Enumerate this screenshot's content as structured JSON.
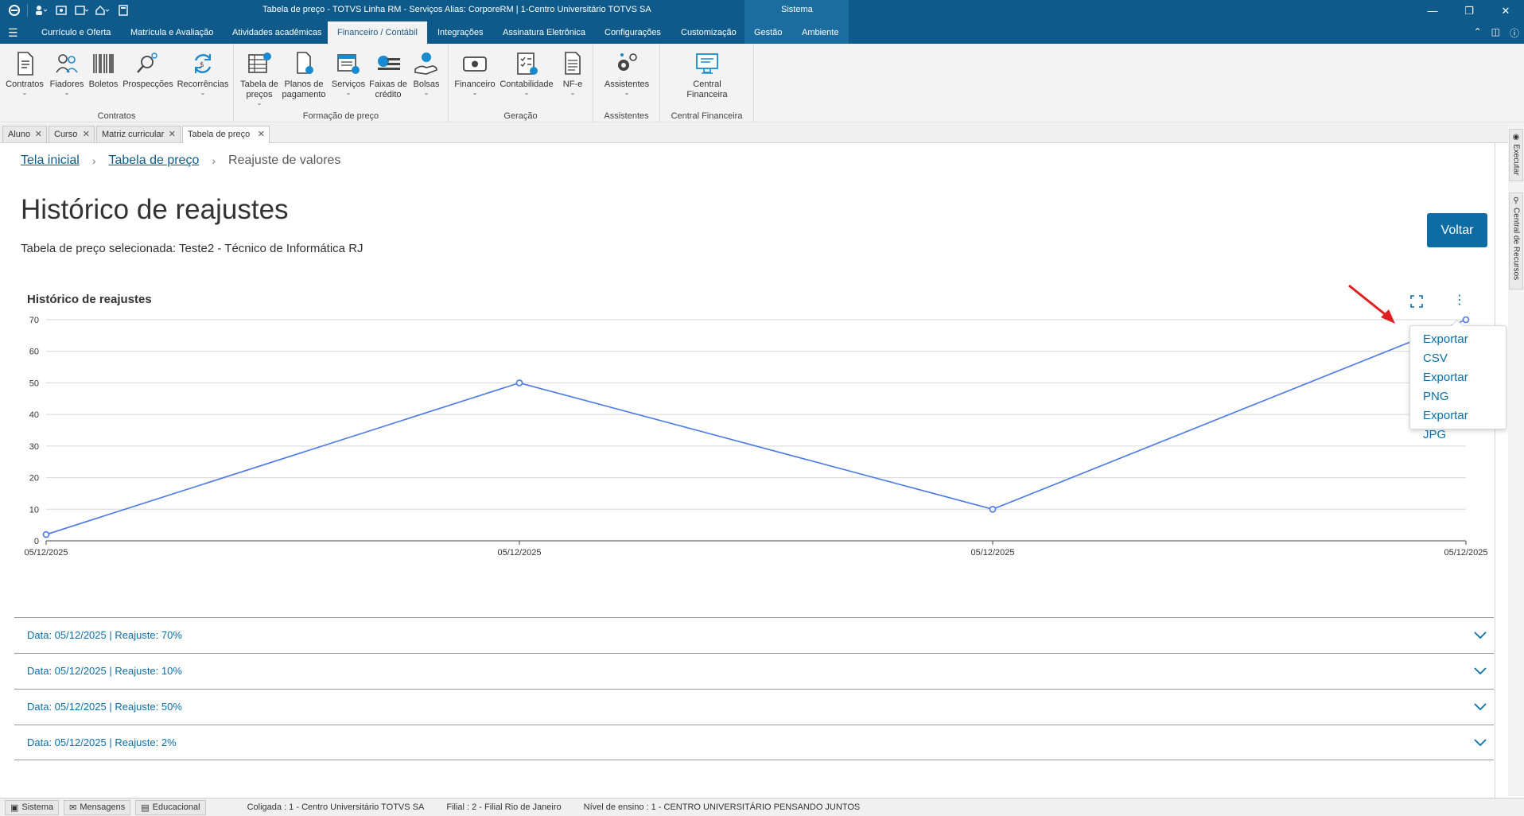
{
  "window": {
    "title": "Tabela de preço - TOTVS Linha RM - Serviços  Alias: CorporeRM | 1-Centro Universitário TOTVS SA",
    "context_tab": "Sistema"
  },
  "ribbon_tabs": [
    {
      "label": "Currículo e Oferta"
    },
    {
      "label": "Matrícula e Avaliação"
    },
    {
      "label": "Atividades acadêmicas"
    },
    {
      "label": "Financeiro / Contábil",
      "active": true
    },
    {
      "label": "Integrações"
    },
    {
      "label": "Assinatura Eletrônica"
    },
    {
      "label": "Configurações"
    },
    {
      "label": "Customização"
    },
    {
      "label": "Gestão"
    },
    {
      "label": "Ambiente"
    }
  ],
  "ribbon": {
    "groups": [
      {
        "label": "Contratos",
        "buttons": [
          {
            "label": "Contratos",
            "icon": "contract-icon",
            "dropdown": true
          },
          {
            "label": "Fiadores",
            "icon": "guarantor-icon",
            "dropdown": true
          },
          {
            "label": "Boletos",
            "icon": "barcode-icon"
          },
          {
            "label": "Prospecções",
            "icon": "prospect-icon"
          },
          {
            "label": "Recorrências",
            "icon": "recurrence-icon",
            "dropdown": true
          }
        ]
      },
      {
        "label": "Formação de preço",
        "buttons": [
          {
            "label": "Tabela de preços",
            "icon": "price-table-icon",
            "dropdown": true
          },
          {
            "label": "Planos de pagamento",
            "icon": "payment-plan-icon"
          },
          {
            "label": "Serviços",
            "icon": "services-icon",
            "dropdown": true
          },
          {
            "label": "Faixas de crédito",
            "icon": "credit-range-icon"
          },
          {
            "label": "Bolsas",
            "icon": "scholarship-icon",
            "dropdown": true
          }
        ]
      },
      {
        "label": "Geração",
        "buttons": [
          {
            "label": "Financeiro",
            "icon": "finance-icon",
            "dropdown": true
          },
          {
            "label": "Contabilidade",
            "icon": "accounting-icon",
            "dropdown": true
          },
          {
            "label": "NF-e",
            "icon": "nfe-icon",
            "dropdown": true
          }
        ]
      },
      {
        "label": "Assistentes",
        "buttons": [
          {
            "label": "Assistentes",
            "icon": "assistants-icon",
            "dropdown": true
          }
        ]
      },
      {
        "label": "Central Financeira",
        "buttons": [
          {
            "label": "Central Financeira",
            "icon": "central-finance-icon"
          }
        ]
      }
    ]
  },
  "doc_tabs": [
    {
      "label": "Aluno"
    },
    {
      "label": "Curso"
    },
    {
      "label": "Matriz curricular"
    },
    {
      "label": "Tabela de preço",
      "active": true
    }
  ],
  "breadcrumb": {
    "home": "Tela inicial",
    "parent": "Tabela de preço",
    "current": "Reajuste de valores"
  },
  "page": {
    "title": "Histórico de reajustes",
    "subtitle": "Tabela de preço selecionada: Teste2 - Técnico de Informática RJ",
    "back_button": "Voltar"
  },
  "chart_panel": {
    "title": "Histórico de reajustes",
    "menu_items": [
      {
        "label": "Exportar CSV"
      },
      {
        "label": "Exportar PNG"
      },
      {
        "label": "Exportar JPG"
      }
    ]
  },
  "chart_data": {
    "type": "line",
    "title": "Histórico de reajustes",
    "categories": [
      "05/12/2025",
      "05/12/2025",
      "05/12/2025",
      "05/12/2025"
    ],
    "series": [
      {
        "values": [
          2,
          50,
          10,
          70
        ]
      }
    ],
    "yticks": [
      0,
      10,
      20,
      30,
      40,
      50,
      60,
      70
    ],
    "ylim": [
      0,
      70
    ],
    "grid": true,
    "color": "#4a78e8"
  },
  "history": [
    {
      "label": "Data: 05/12/2025 | Reajuste: 70%"
    },
    {
      "label": "Data: 05/12/2025 | Reajuste: 10%"
    },
    {
      "label": "Data: 05/12/2025 | Reajuste: 50%"
    },
    {
      "label": "Data: 05/12/2025 | Reajuste: 2%"
    }
  ],
  "side_panel": {
    "tabs": [
      {
        "label": "Executar"
      },
      {
        "label": "Central de Recursos"
      }
    ]
  },
  "statusbar": {
    "buttons": [
      {
        "label": "Sistema"
      },
      {
        "label": "Mensagens"
      },
      {
        "label": "Educacional"
      }
    ],
    "coligada": "Coligada : 1 - Centro Universitário TOTVS SA",
    "filial": "Filial : 2 - Filial Rio de Janeiro",
    "nivel": "Nível de ensino : 1 - CENTRO UNIVERSITÁRIO PENSANDO JUNTOS"
  }
}
